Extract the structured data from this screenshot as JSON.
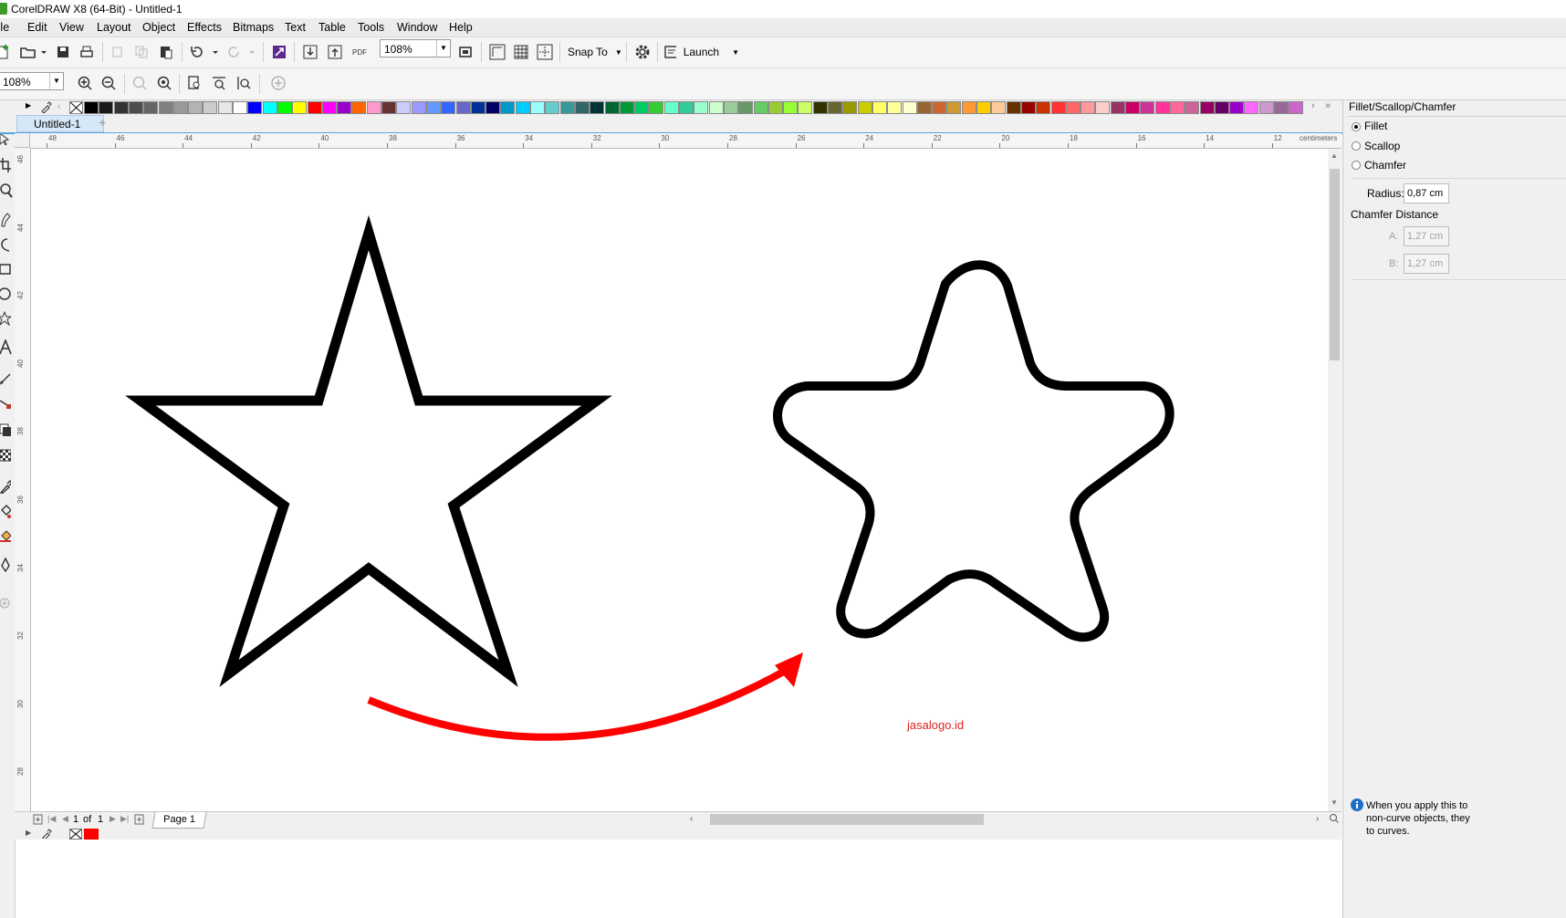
{
  "window": {
    "title": "CorelDRAW X8 (64-Bit) - Untitled-1"
  },
  "menu": [
    "File",
    "Edit",
    "View",
    "Layout",
    "Object",
    "Effects",
    "Bitmaps",
    "Text",
    "Table",
    "Tools",
    "Window",
    "Help"
  ],
  "toolbar": {
    "zoom_value": "108%",
    "snap_label": "Snap To",
    "launch_label": "Launch",
    "pdf_label": "PDF"
  },
  "property_bar": {
    "zoom_value": "108%"
  },
  "document": {
    "tab_label": "Untitled-1"
  },
  "ruler": {
    "units": "centimeters",
    "horizontal_ticks": [
      "48",
      "46",
      "44",
      "42",
      "40",
      "38",
      "36",
      "34",
      "32",
      "30",
      "28",
      "26",
      "24",
      "22",
      "20",
      "18",
      "16",
      "14",
      "12"
    ],
    "vertical_ticks": [
      "46",
      "44",
      "42",
      "40",
      "38",
      "36",
      "34",
      "32",
      "30",
      "28"
    ]
  },
  "palette": {
    "colors": [
      "#000000",
      "#1a1a1a",
      "#333333",
      "#4d4d4d",
      "#666666",
      "#808080",
      "#999999",
      "#b3b3b3",
      "#cccccc",
      "#e6e6e6",
      "#ffffff",
      "#0000ff",
      "#00ffff",
      "#00ff00",
      "#ffff00",
      "#ff0000",
      "#ff00ff",
      "#9900cc",
      "#ff6600",
      "#ff99cc",
      "#663333",
      "#ccccff",
      "#9999ff",
      "#6699ff",
      "#3366ff",
      "#6666cc",
      "#003399",
      "#000066",
      "#0099cc",
      "#00ccff",
      "#99ffff",
      "#66cccc",
      "#339999",
      "#336666",
      "#003333",
      "#006633",
      "#009933",
      "#00cc66",
      "#33cc33",
      "#66ffcc",
      "#33cc99",
      "#99ffcc",
      "#ccffcc",
      "#99cc99",
      "#669966",
      "#66cc66",
      "#99cc33",
      "#99ff33",
      "#ccff66",
      "#333300",
      "#666633",
      "#999900",
      "#cccc00",
      "#ffff66",
      "#ffff99",
      "#ffffcc",
      "#996633",
      "#cc6633",
      "#cc9933",
      "#ff9933",
      "#ffcc00",
      "#ffcc99",
      "#663300",
      "#990000",
      "#cc3300",
      "#ff3333",
      "#ff6666",
      "#ff9999",
      "#ffcccc",
      "#993366",
      "#cc0066",
      "#cc3399",
      "#ff3399",
      "#ff6699",
      "#cc6699",
      "#990066",
      "#660066",
      "#9900cc",
      "#ff66ff",
      "#cc99cc",
      "#996699",
      "#cc66cc"
    ]
  },
  "page_nav": {
    "current": "1",
    "of_label": "of",
    "total": "1",
    "page_tab": "Page 1"
  },
  "canvas": {
    "watermark_text": "jasalogo.id",
    "star_outline_color": "#000000",
    "arrow_color": "#ff0000"
  },
  "status": {
    "fill_color": "#ff0000"
  },
  "docker": {
    "title": "Fillet/Scallop/Chamfer",
    "options": [
      {
        "label": "Fillet",
        "selected": true
      },
      {
        "label": "Scallop",
        "selected": false
      },
      {
        "label": "Chamfer",
        "selected": false
      }
    ],
    "radius_label": "Radius:",
    "radius_value": "0,87 cm",
    "chamfer_distance_label": "Chamfer Distance",
    "a_label": "A:",
    "a_value": "1,27 cm",
    "b_label": "B:",
    "b_value": "1,27 cm",
    "info_text_lines": [
      "When you apply this to",
      "non-curve objects, they",
      "to curves."
    ]
  }
}
